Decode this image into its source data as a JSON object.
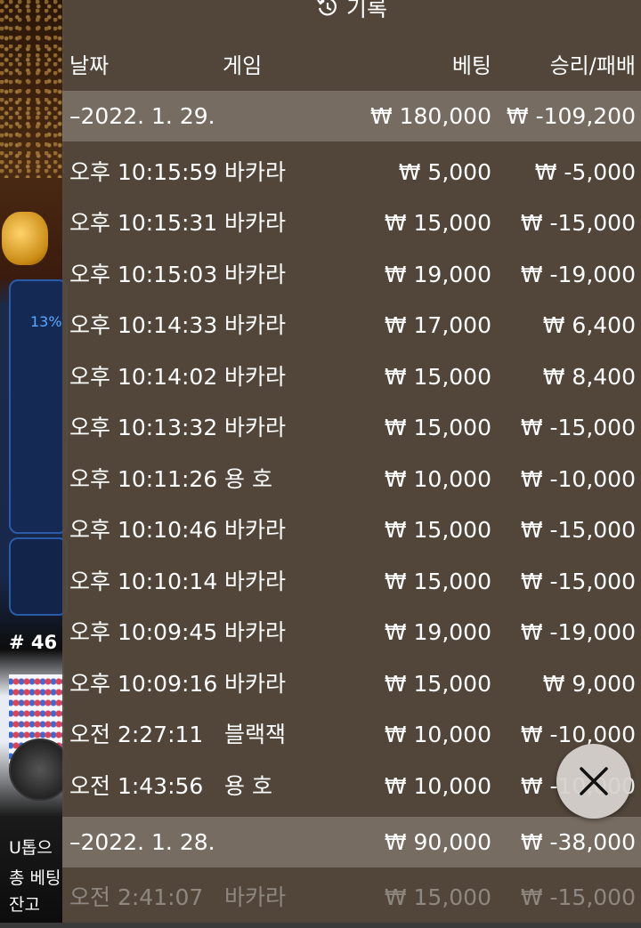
{
  "header": {
    "title": "기록",
    "icon": "history-clock-icon"
  },
  "columns": {
    "date": "날짜",
    "game": "게임",
    "bet": "베팅",
    "result": "승리/패배"
  },
  "groups": [
    {
      "date": "–2022. 1. 29.",
      "total_bet": "₩ 180,000",
      "total_result": "₩ -109,200",
      "rows": [
        {
          "time": "오후 10:15:59",
          "game": "바카라",
          "bet": "₩ 5,000",
          "result": "₩ -5,000"
        },
        {
          "time": "오후 10:15:31",
          "game": "바카라",
          "bet": "₩ 15,000",
          "result": "₩ -15,000"
        },
        {
          "time": "오후 10:15:03",
          "game": "바카라",
          "bet": "₩ 19,000",
          "result": "₩ -19,000"
        },
        {
          "time": "오후 10:14:33",
          "game": "바카라",
          "bet": "₩ 17,000",
          "result": "₩ 6,400"
        },
        {
          "time": "오후 10:14:02",
          "game": "바카라",
          "bet": "₩ 15,000",
          "result": "₩ 8,400"
        },
        {
          "time": "오후 10:13:32",
          "game": "바카라",
          "bet": "₩ 15,000",
          "result": "₩ -15,000"
        },
        {
          "time": "오후 10:11:26",
          "game": "용 호",
          "bet": "₩ 10,000",
          "result": "₩ -10,000"
        },
        {
          "time": "오후 10:10:46",
          "game": "바카라",
          "bet": "₩ 15,000",
          "result": "₩ -15,000"
        },
        {
          "time": "오후 10:10:14",
          "game": "바카라",
          "bet": "₩ 15,000",
          "result": "₩ -15,000"
        },
        {
          "time": "오후 10:09:45",
          "game": "바카라",
          "bet": "₩ 19,000",
          "result": "₩ -19,000"
        },
        {
          "time": "오후 10:09:16",
          "game": "바카라",
          "bet": "₩ 15,000",
          "result": "₩ 9,000"
        },
        {
          "time": "오전 2:27:11",
          "game": "블랙잭",
          "bet": "₩ 10,000",
          "result": "₩ -10,000"
        },
        {
          "time": "오전 1:43:56",
          "game": "용 호",
          "bet": "₩ 10,000",
          "result": "₩ -10,000"
        }
      ]
    },
    {
      "date": "–2022. 1. 28.",
      "total_bet": "₩ 90,000",
      "total_result": "₩ -38,000",
      "rows": [
        {
          "time": "오전 2:41:07",
          "game": "바카라",
          "bet": "₩ 15,000",
          "result": "₩ -15,000"
        }
      ]
    }
  ],
  "background": {
    "percent": "13%",
    "table_number": "# 46",
    "line1": "U톱으",
    "line2": "총 베팅",
    "line3": "잔고"
  },
  "colors": {
    "overlay": "#564a3e",
    "date_row": "#8f857b",
    "accent_blue": "#2a5aa8"
  },
  "close_button": {
    "icon": "close-icon"
  }
}
